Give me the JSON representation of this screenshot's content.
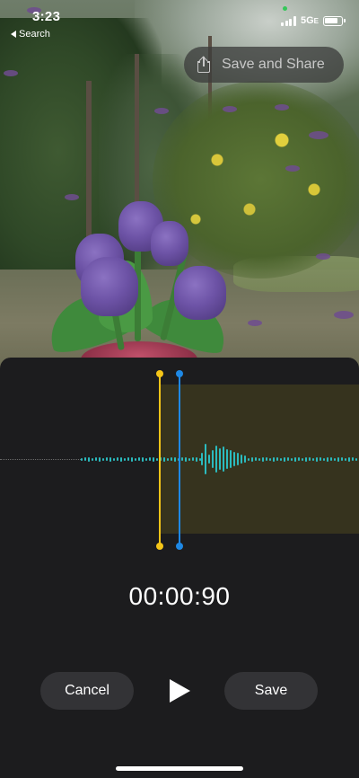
{
  "status_bar": {
    "time": "3:23",
    "back_label": "Search",
    "network": "5G",
    "network_suffix": "E"
  },
  "share_button": {
    "label": "Save and Share",
    "icon": "share-icon"
  },
  "editor": {
    "timer": "00:00:90",
    "cancel_label": "Cancel",
    "save_label": "Save",
    "play_icon": "play-icon"
  },
  "colors": {
    "waveform": "#2bbbbf",
    "start_handle": "#f5c518",
    "playhead": "#1e88e5",
    "sheet_background": "#1c1c1e"
  }
}
